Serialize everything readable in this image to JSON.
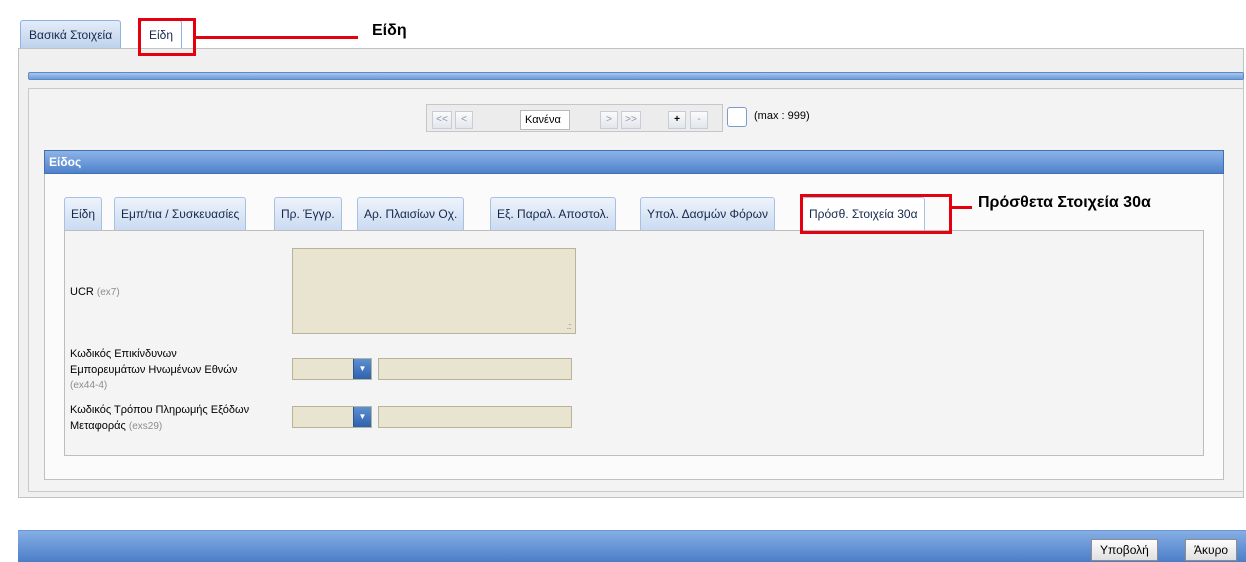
{
  "outer_tabs": [
    {
      "label": "Βασικά Στοιχεία"
    },
    {
      "label": "Είδη"
    }
  ],
  "pager": {
    "first": "<<",
    "prev": "<",
    "current": "Κανένα",
    "next": ">",
    "last": ">>",
    "add": "+",
    "remove": "-",
    "max": "(max : 999)"
  },
  "eidos_section": {
    "title": "Είδος",
    "tabs": [
      {
        "label": "Είδη"
      },
      {
        "label": "Εμπ/τια / Συσκευασίες"
      },
      {
        "label": "Πρ. Έγγρ."
      },
      {
        "label": "Αρ. Πλαισίων Οχ."
      },
      {
        "label": "Εξ. Παραλ. Αποστολ."
      },
      {
        "label": "Υπολ. Δασμών Φόρων"
      },
      {
        "label": "Πρόσθ. Στοιχεία 30α"
      }
    ],
    "active_tab": "Πρόσθ. Στοιχεία 30α"
  },
  "form": {
    "ucr": {
      "label": "UCR",
      "code": "(ex7)"
    },
    "dangerous_goods": {
      "label_line1": "Κωδικός Επικίνδυνων",
      "label_line2": "Εμπορευμάτων Ηνωμένων Εθνών",
      "code": "(ex44-4)"
    },
    "payment_method": {
      "label_line1": "Κωδικός Τρόπου Πληρωμής Εξόδων",
      "label_line2": "Μεταφοράς",
      "code": "(exs29)"
    }
  },
  "buttons": {
    "submit": "Υποβολή",
    "cancel": "Άκυρο"
  },
  "annotations": {
    "eidi_callout": "Είδη",
    "extra_callout": "Πρόσθετα Στοιχεία 30α"
  },
  "colors": {
    "highlight": "#e3000f",
    "header_blue": "#4f82cb",
    "field_beige": "#e8e4cf"
  }
}
